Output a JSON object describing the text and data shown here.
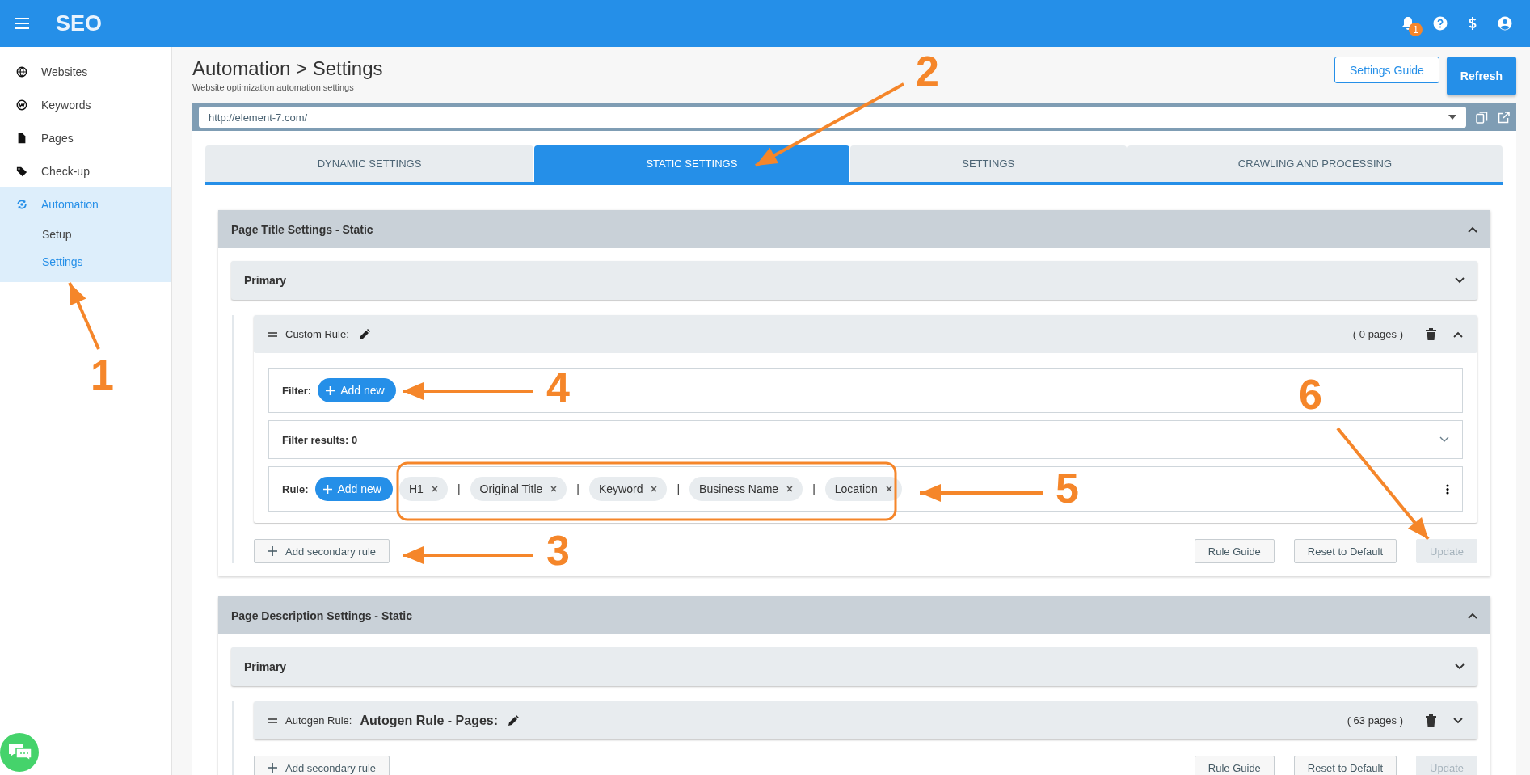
{
  "app_bar": {
    "title": "SEO",
    "notification_count": "1"
  },
  "sidebar": {
    "items": [
      {
        "label": "Websites",
        "selected": false
      },
      {
        "label": "Keywords",
        "selected": false
      },
      {
        "label": "Pages",
        "selected": false
      },
      {
        "label": "Check-up",
        "selected": false
      },
      {
        "label": "Automation",
        "selected": true,
        "children": [
          {
            "label": "Setup",
            "selected": false
          },
          {
            "label": "Settings",
            "selected": true
          }
        ]
      }
    ]
  },
  "page": {
    "title": "Automation > Settings",
    "subtitle": "Website optimization automation settings",
    "buttons": [
      {
        "label": "Settings Guide",
        "kind": "outline"
      },
      {
        "label": "Refresh",
        "kind": "primary"
      }
    ]
  },
  "site_select": {
    "value": "http://element-7.com/"
  },
  "tabs": [
    {
      "label": "DYNAMIC SETTINGS",
      "selected": false
    },
    {
      "label": "STATIC SETTINGS",
      "selected": true
    },
    {
      "label": "SETTINGS",
      "selected": false
    },
    {
      "label": "CRAWLING AND PROCESSING",
      "selected": false
    }
  ],
  "sections": [
    {
      "title": "Page Title Settings - Static",
      "expanded": true,
      "primary": {
        "label": "Primary",
        "expanded": false
      },
      "rule": {
        "type_label": "Custom Rule:",
        "pages": "( 0 pages )",
        "expanded": true,
        "filter_label": "Filter:",
        "filter_add": "Add new",
        "filter_results": "Filter results: 0",
        "rule_label": "Rule:",
        "rule_add": "Add new",
        "tokens": [
          {
            "kind": "chip",
            "label": "H1"
          },
          {
            "kind": "separator",
            "label": "|"
          },
          {
            "kind": "chip",
            "label": "Original Title"
          },
          {
            "kind": "separator",
            "label": "|"
          },
          {
            "kind": "chip",
            "label": "Keyword"
          },
          {
            "kind": "separator",
            "label": "|"
          },
          {
            "kind": "chip",
            "label": "Business Name"
          },
          {
            "kind": "separator",
            "label": "|"
          },
          {
            "kind": "chip",
            "label": "Location"
          }
        ]
      },
      "secondary_button": "Add secondary rule",
      "actions": [
        {
          "label": "Rule Guide",
          "disabled": false
        },
        {
          "label": "Reset to Default",
          "disabled": false
        },
        {
          "label": "Update",
          "disabled": true
        }
      ]
    },
    {
      "title": "Page Description Settings - Static",
      "expanded": true,
      "primary": {
        "label": "Primary",
        "expanded": false
      },
      "rule": {
        "type_label": "Autogen Rule:",
        "name": "Autogen Rule - Pages:",
        "pages": "( 63 pages )",
        "expanded": false
      },
      "secondary_button": "Add secondary rule",
      "actions": [
        {
          "label": "Rule Guide",
          "disabled": false
        },
        {
          "label": "Reset to Default",
          "disabled": false
        },
        {
          "label": "Update",
          "disabled": true
        }
      ]
    }
  ],
  "annotations": [
    {
      "number": "1"
    },
    {
      "number": "2"
    },
    {
      "number": "3"
    },
    {
      "number": "4"
    },
    {
      "number": "5"
    },
    {
      "number": "6"
    }
  ]
}
